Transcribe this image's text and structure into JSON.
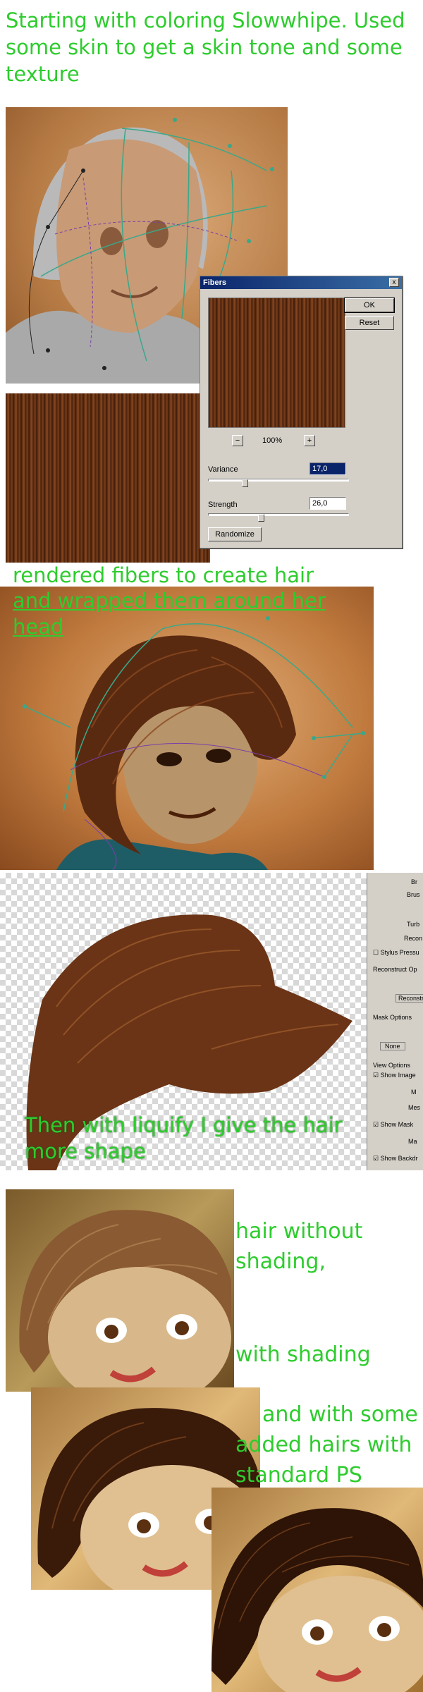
{
  "captions": {
    "intro": "Starting with coloring Slowwhipe. Used some skin to get a skin tone and some texture",
    "fibers_line1": "rendered fibers to create hair",
    "fibers_line2": "and wrapped them around her head",
    "liquify_line1": "Then with liquify I give the hair",
    "liquify_line2": "more shape",
    "no_shading_1": "hair without",
    "no_shading_2": "shading,",
    "with_shading": "with shading",
    "added_1": "and with some",
    "added_2": "added hairs with",
    "added_3": "standard PS brush"
  },
  "fibers_dialog": {
    "title": "Fibers",
    "close": "x",
    "ok": "OK",
    "reset": "Reset",
    "zoom": "100%",
    "zoom_out": "−",
    "zoom_in": "+",
    "variance_label": "Variance",
    "variance_value": "17,0",
    "strength_label": "Strength",
    "strength_value": "26,0",
    "randomize": "Randomize"
  },
  "liquify_panel": {
    "items": [
      "Br",
      "Brus",
      "Turb",
      "Recon",
      "Stylus Pressu",
      "Reconstruct Op",
      "Reconstr",
      "Mask Options",
      "None",
      "View Options",
      "Show Image",
      "M",
      "Mes",
      "Show Mask",
      "Ma",
      "Show Backdr"
    ]
  },
  "colors": {
    "caption_green": "#2ecc2e",
    "hair_brown": "#5a2a10",
    "bg_orange": "#c8864a"
  }
}
